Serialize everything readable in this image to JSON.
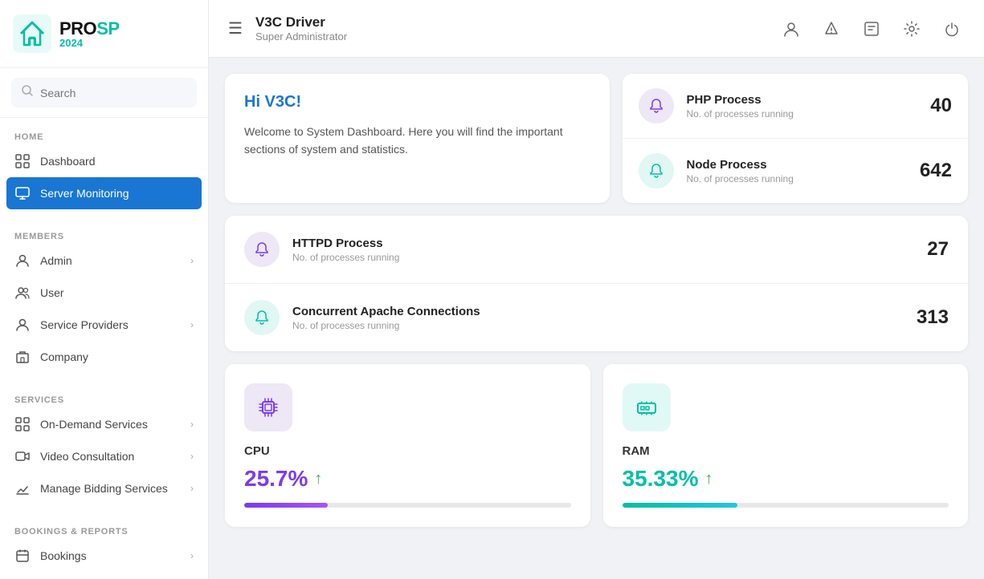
{
  "sidebar": {
    "logo": {
      "brand": "PROSP",
      "brand_colored": "PRO",
      "brand_colored2": "SP",
      "year": "2024"
    },
    "search": {
      "placeholder": "Search"
    },
    "sections": [
      {
        "label": "HOME",
        "items": [
          {
            "id": "dashboard",
            "label": "Dashboard",
            "icon": "grid-icon",
            "active": false,
            "has_chevron": false
          },
          {
            "id": "server-monitoring",
            "label": "Server Monitoring",
            "icon": "monitor-icon",
            "active": true,
            "has_chevron": false
          }
        ]
      },
      {
        "label": "MEMBERS",
        "items": [
          {
            "id": "admin",
            "label": "Admin",
            "icon": "person-icon",
            "active": false,
            "has_chevron": true
          },
          {
            "id": "user",
            "label": "User",
            "icon": "group-icon",
            "active": false,
            "has_chevron": false
          },
          {
            "id": "service-providers",
            "label": "Service Providers",
            "icon": "person-outline-icon",
            "active": false,
            "has_chevron": true
          },
          {
            "id": "company",
            "label": "Company",
            "icon": "company-icon",
            "active": false,
            "has_chevron": false
          }
        ]
      },
      {
        "label": "SERVICES",
        "items": [
          {
            "id": "on-demand-services",
            "label": "On-Demand Services",
            "icon": "apps-icon",
            "active": false,
            "has_chevron": true
          },
          {
            "id": "video-consultation",
            "label": "Video Consultation",
            "icon": "video-icon",
            "active": false,
            "has_chevron": true
          },
          {
            "id": "manage-bidding",
            "label": "Manage Bidding Services",
            "icon": "bid-icon",
            "active": false,
            "has_chevron": true
          }
        ]
      },
      {
        "label": "BOOKINGS & REPORTS",
        "items": [
          {
            "id": "bookings",
            "label": "Bookings",
            "icon": "calendar-icon",
            "active": false,
            "has_chevron": true
          }
        ]
      }
    ]
  },
  "topbar": {
    "title": "V3C Driver",
    "subtitle": "Super Administrator",
    "menu_icon": "☰"
  },
  "main": {
    "welcome": {
      "greeting": "Hi V3C!",
      "message": "Welcome to System Dashboard. Here you will find the important sections of system and statistics."
    },
    "processes": [
      {
        "id": "php",
        "label": "PHP Process",
        "sub": "No. of processes running",
        "count": "40",
        "icon_color": "purple"
      },
      {
        "id": "node",
        "label": "Node Process",
        "sub": "No. of processes running",
        "count": "642",
        "icon_color": "teal"
      }
    ],
    "processes_wide": [
      {
        "id": "httpd",
        "label": "HTTPD Process",
        "sub": "No. of processes running",
        "count": "27",
        "icon_color": "purple"
      },
      {
        "id": "apache",
        "label": "Concurrent Apache Connections",
        "sub": "No. of processes running",
        "count": "313",
        "icon_color": "teal"
      }
    ],
    "stats": [
      {
        "id": "cpu",
        "label": "CPU",
        "value": "25.7%",
        "progress": 25.7,
        "icon_color": "purple",
        "color_class": "purple-val"
      },
      {
        "id": "ram",
        "label": "RAM",
        "value": "35.33%",
        "progress": 35.33,
        "icon_color": "teal",
        "color_class": "teal-val"
      }
    ]
  }
}
